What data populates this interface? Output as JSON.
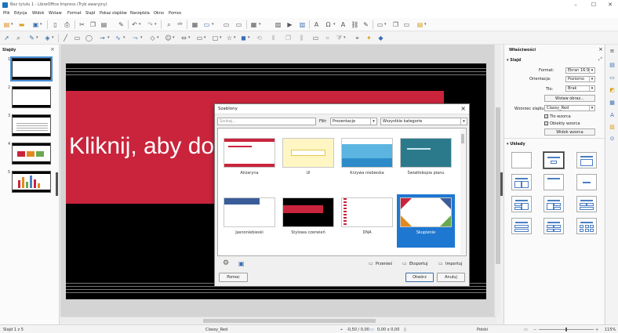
{
  "window": {
    "title": "Bez tytułu 1 - LibreOffice Impress (Tryb awaryjny)"
  },
  "menubar": {
    "items": [
      "Plik",
      "Edycja",
      "Widok",
      "Wstaw",
      "Format",
      "Slajd",
      "Pokaz slajdów",
      "Narzędzia",
      "Okno",
      "Pomoc"
    ]
  },
  "slide_panel": {
    "title": "Slajdy",
    "thumbs": [
      "1",
      "2",
      "3",
      "4",
      "5"
    ]
  },
  "slide": {
    "title_text": "Kliknij, aby do"
  },
  "sidebar": {
    "title": "Właściwości",
    "section_slide": "Slajd",
    "format_label": "Format:",
    "format_value": "Ekran 16:9",
    "orientation_label": "Orientacja:",
    "orientation_value": "Poziomo",
    "background_label": "Tło:",
    "background_value": "Brak",
    "insert_image_button": "Wstaw obraz...",
    "master_slide_label": "Wzorzec slajdu:",
    "master_slide_value": "Classy_Red",
    "master_background_label": "Tło wzorca",
    "master_objects_label": "Obiekty wzorca",
    "master_view_button": "Widok wzorca",
    "section_layouts": "Układy"
  },
  "dialog": {
    "title": "Szablony",
    "search_placeholder": "Szukaj...",
    "filter_label": "Filtr",
    "filter_value": "Prezentacje",
    "category_value": "Wszystkie kategorie",
    "templates": [
      "Alizaryna",
      "Ul",
      "Krzywa niebieska",
      "Światłokopia planu",
      "Jasnoniebieski",
      "Stylowa czerwień",
      "DNA",
      "Skupienie"
    ],
    "selected_template": "Skupienie",
    "move_link": "Przenieś",
    "export_link": "Eksportuj",
    "import_link": "Importuj",
    "help_button": "Pomoc",
    "open_button": "Otwórz",
    "cancel_button": "Anuluj"
  },
  "statusbar": {
    "slide_count": "Slajd 1 z 5",
    "master": "Classy_Red",
    "position": "-0,50 / 0,00",
    "size": "0,00 x 0,00",
    "language": "Polski",
    "zoom": "115%"
  }
}
